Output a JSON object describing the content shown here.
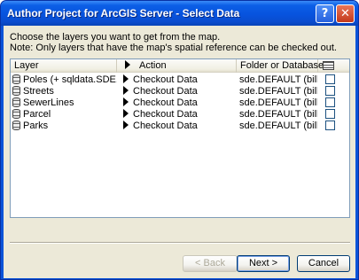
{
  "window": {
    "title": "Author Project for ArcGIS Server - Select Data",
    "help_label": "?",
    "close_label": "✕"
  },
  "instructions": {
    "line1": "Choose the layers you want to get from the map.",
    "line2": "Note: Only layers that have the map's spatial reference can be checked out."
  },
  "table": {
    "headers": {
      "layer": "Layer",
      "action": "Action",
      "folder": "Folder or Database"
    },
    "rows": [
      {
        "layer": "Poles (+ sqldata.SDE.Ri...",
        "action": "Checkout Data",
        "folder": "sde.DEFAULT (billy...",
        "checked": false
      },
      {
        "layer": "Streets",
        "action": "Checkout Data",
        "folder": "sde.DEFAULT (billy...",
        "checked": false
      },
      {
        "layer": "SewerLines",
        "action": "Checkout Data",
        "folder": "sde.DEFAULT (billy...",
        "checked": false
      },
      {
        "layer": "Parcel",
        "action": "Checkout Data",
        "folder": "sde.DEFAULT (billy...",
        "checked": false
      },
      {
        "layer": "Parks",
        "action": "Checkout Data",
        "folder": "sde.DEFAULT (billy...",
        "checked": false
      }
    ]
  },
  "buttons": {
    "back": "< Back",
    "next": "Next >",
    "cancel": "Cancel"
  }
}
